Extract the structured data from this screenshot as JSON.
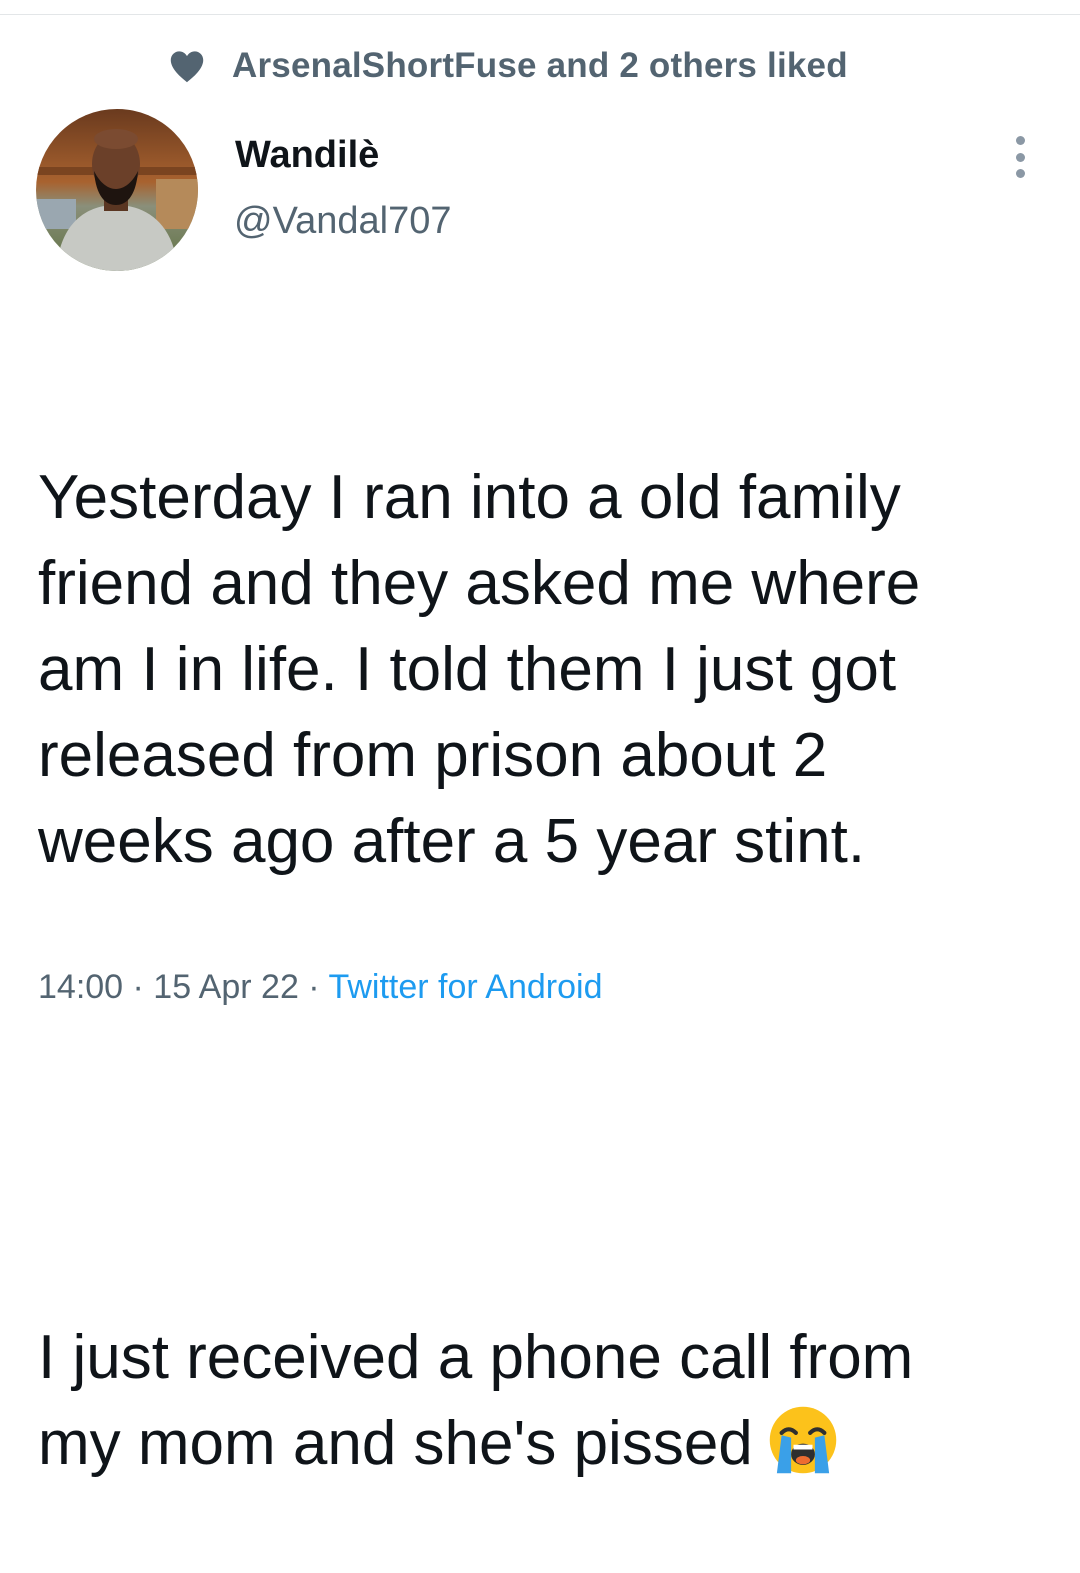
{
  "social_context": {
    "icon": "heart-icon",
    "text": "ArsenalShortFuse and 2 others liked"
  },
  "author": {
    "display_name": "Wandilè",
    "handle": "@Vandal707",
    "avatar": "avatar"
  },
  "more_options": {
    "icon": "more-vertical-icon"
  },
  "tweet": {
    "paragraph_1": "Yesterday I ran into a old family\nfriend and they asked me where\nam I in life. I told them I just got\nreleased from prison about 2\nweeks ago after a 5 year stint.",
    "paragraph_2": "I just received a phone call from\nmy mom and she's pissed",
    "emoji": "loudly-crying-face-icon"
  },
  "meta": {
    "time_date": "14:00 · 15 Apr 22 ·",
    "source": "Twitter for Android"
  },
  "colors": {
    "secondary_text": "#536471",
    "primary_text": "#0f1419",
    "link": "#1d9bf0"
  }
}
